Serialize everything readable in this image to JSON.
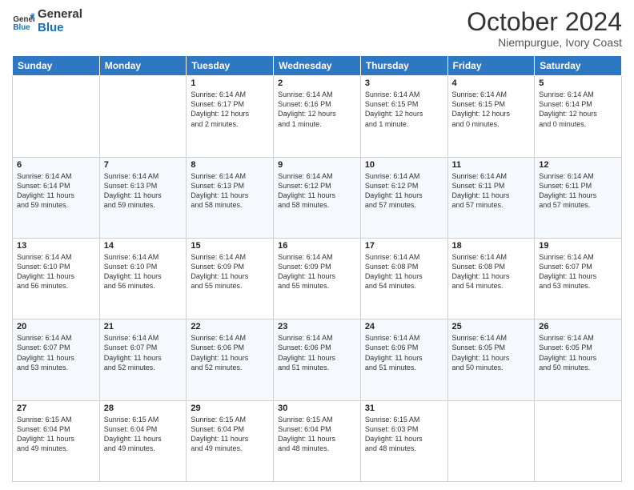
{
  "header": {
    "logo_line1": "General",
    "logo_line2": "Blue",
    "month": "October 2024",
    "location": "Niempurgue, Ivory Coast"
  },
  "days_of_week": [
    "Sunday",
    "Monday",
    "Tuesday",
    "Wednesday",
    "Thursday",
    "Friday",
    "Saturday"
  ],
  "weeks": [
    [
      {
        "day": "",
        "info": ""
      },
      {
        "day": "",
        "info": ""
      },
      {
        "day": "1",
        "info": "Sunrise: 6:14 AM\nSunset: 6:17 PM\nDaylight: 12 hours\nand 2 minutes."
      },
      {
        "day": "2",
        "info": "Sunrise: 6:14 AM\nSunset: 6:16 PM\nDaylight: 12 hours\nand 1 minute."
      },
      {
        "day": "3",
        "info": "Sunrise: 6:14 AM\nSunset: 6:15 PM\nDaylight: 12 hours\nand 1 minute."
      },
      {
        "day": "4",
        "info": "Sunrise: 6:14 AM\nSunset: 6:15 PM\nDaylight: 12 hours\nand 0 minutes."
      },
      {
        "day": "5",
        "info": "Sunrise: 6:14 AM\nSunset: 6:14 PM\nDaylight: 12 hours\nand 0 minutes."
      }
    ],
    [
      {
        "day": "6",
        "info": "Sunrise: 6:14 AM\nSunset: 6:14 PM\nDaylight: 11 hours\nand 59 minutes."
      },
      {
        "day": "7",
        "info": "Sunrise: 6:14 AM\nSunset: 6:13 PM\nDaylight: 11 hours\nand 59 minutes."
      },
      {
        "day": "8",
        "info": "Sunrise: 6:14 AM\nSunset: 6:13 PM\nDaylight: 11 hours\nand 58 minutes."
      },
      {
        "day": "9",
        "info": "Sunrise: 6:14 AM\nSunset: 6:12 PM\nDaylight: 11 hours\nand 58 minutes."
      },
      {
        "day": "10",
        "info": "Sunrise: 6:14 AM\nSunset: 6:12 PM\nDaylight: 11 hours\nand 57 minutes."
      },
      {
        "day": "11",
        "info": "Sunrise: 6:14 AM\nSunset: 6:11 PM\nDaylight: 11 hours\nand 57 minutes."
      },
      {
        "day": "12",
        "info": "Sunrise: 6:14 AM\nSunset: 6:11 PM\nDaylight: 11 hours\nand 57 minutes."
      }
    ],
    [
      {
        "day": "13",
        "info": "Sunrise: 6:14 AM\nSunset: 6:10 PM\nDaylight: 11 hours\nand 56 minutes."
      },
      {
        "day": "14",
        "info": "Sunrise: 6:14 AM\nSunset: 6:10 PM\nDaylight: 11 hours\nand 56 minutes."
      },
      {
        "day": "15",
        "info": "Sunrise: 6:14 AM\nSunset: 6:09 PM\nDaylight: 11 hours\nand 55 minutes."
      },
      {
        "day": "16",
        "info": "Sunrise: 6:14 AM\nSunset: 6:09 PM\nDaylight: 11 hours\nand 55 minutes."
      },
      {
        "day": "17",
        "info": "Sunrise: 6:14 AM\nSunset: 6:08 PM\nDaylight: 11 hours\nand 54 minutes."
      },
      {
        "day": "18",
        "info": "Sunrise: 6:14 AM\nSunset: 6:08 PM\nDaylight: 11 hours\nand 54 minutes."
      },
      {
        "day": "19",
        "info": "Sunrise: 6:14 AM\nSunset: 6:07 PM\nDaylight: 11 hours\nand 53 minutes."
      }
    ],
    [
      {
        "day": "20",
        "info": "Sunrise: 6:14 AM\nSunset: 6:07 PM\nDaylight: 11 hours\nand 53 minutes."
      },
      {
        "day": "21",
        "info": "Sunrise: 6:14 AM\nSunset: 6:07 PM\nDaylight: 11 hours\nand 52 minutes."
      },
      {
        "day": "22",
        "info": "Sunrise: 6:14 AM\nSunset: 6:06 PM\nDaylight: 11 hours\nand 52 minutes."
      },
      {
        "day": "23",
        "info": "Sunrise: 6:14 AM\nSunset: 6:06 PM\nDaylight: 11 hours\nand 51 minutes."
      },
      {
        "day": "24",
        "info": "Sunrise: 6:14 AM\nSunset: 6:06 PM\nDaylight: 11 hours\nand 51 minutes."
      },
      {
        "day": "25",
        "info": "Sunrise: 6:14 AM\nSunset: 6:05 PM\nDaylight: 11 hours\nand 50 minutes."
      },
      {
        "day": "26",
        "info": "Sunrise: 6:14 AM\nSunset: 6:05 PM\nDaylight: 11 hours\nand 50 minutes."
      }
    ],
    [
      {
        "day": "27",
        "info": "Sunrise: 6:15 AM\nSunset: 6:04 PM\nDaylight: 11 hours\nand 49 minutes."
      },
      {
        "day": "28",
        "info": "Sunrise: 6:15 AM\nSunset: 6:04 PM\nDaylight: 11 hours\nand 49 minutes."
      },
      {
        "day": "29",
        "info": "Sunrise: 6:15 AM\nSunset: 6:04 PM\nDaylight: 11 hours\nand 49 minutes."
      },
      {
        "day": "30",
        "info": "Sunrise: 6:15 AM\nSunset: 6:04 PM\nDaylight: 11 hours\nand 48 minutes."
      },
      {
        "day": "31",
        "info": "Sunrise: 6:15 AM\nSunset: 6:03 PM\nDaylight: 11 hours\nand 48 minutes."
      },
      {
        "day": "",
        "info": ""
      },
      {
        "day": "",
        "info": ""
      }
    ]
  ]
}
